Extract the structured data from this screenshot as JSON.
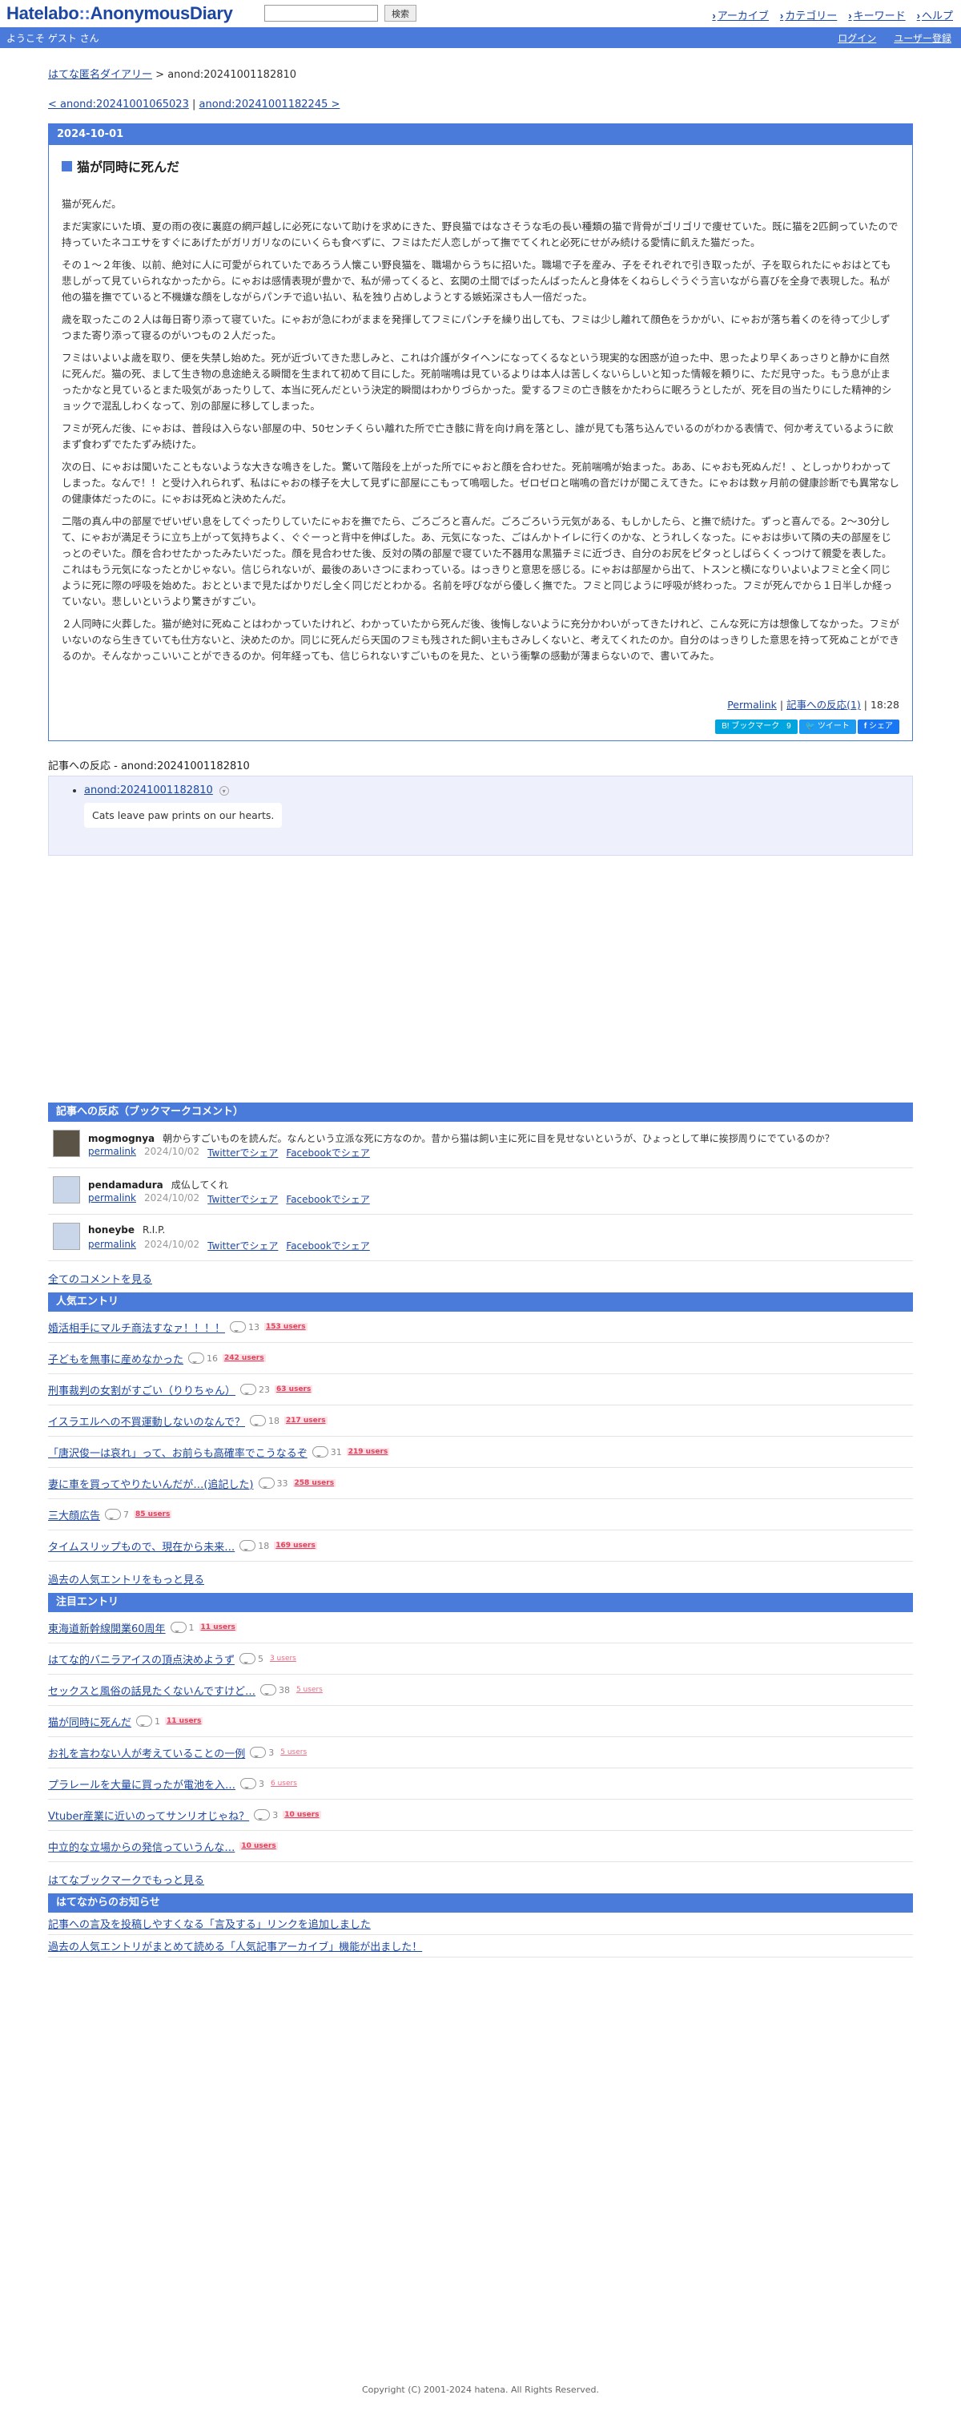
{
  "header": {
    "logo_part1": "Hatelabo",
    "logo_sep": "::",
    "logo_part2": "AnonymousDiary",
    "search_value": "",
    "search_button": "検索",
    "nav": [
      "アーカイブ",
      "カテゴリー",
      "キーワード",
      "ヘルプ"
    ]
  },
  "welcome": {
    "greeting": "ようこそ ゲスト さん",
    "login": "ログイン",
    "register": "ユーザー登録"
  },
  "breadcrumb": {
    "home": "はてな匿名ダイアリー",
    "sep": ">",
    "current": "anond:20241001182810"
  },
  "prevnext": {
    "prev": "< anond:20241001065023",
    "divider": "|",
    "next": "anond:20241001182245 >"
  },
  "entry": {
    "date": "2024-10-01",
    "title": "猫が同時に死んだ",
    "paragraphs": [
      "猫が死んだ。",
      "まだ実家にいた頃、夏の雨の夜に裏庭の網戸越しに必死にないて助けを求めにきた、野良猫ではなさそうな毛の長い種類の猫で背骨がゴリゴリで痩せていた。既に猫を2匹飼っていたので持っていたネコエサをすぐにあげたがガリガリなのにいくらも食べずに、フミはただ人恋しがって撫でてくれと必死にせがみ続ける愛情に飢えた猫だった。",
      "その１～２年後、以前、絶対に人に可愛がられていたであろう人懐こい野良猫を、職場からうちに招いた。職場で子を産み、子をそれぞれで引き取ったが、子を取られたにゃおはとても悲しがって見ていられなかったから。にゃおは感情表現が豊かで、私が帰ってくると、玄関の土間でばったんばったんと身体をくねらしぐうぐう言いながら喜びを全身で表現した。私が他の猫を撫でていると不機嫌な顔をしながらパンチで追い払い、私を独り占めしようとする嫉妬深さも人一倍だった。",
      "歳を取ったこの２人は毎日寄り添って寝ていた。にゃおが急にわがままを発揮してフミにパンチを繰り出しても、フミは少し離れて顔色をうかがい、にゃおが落ち着くのを待って少しずつまた寄り添って寝るのがいつもの２人だった。",
      "フミはいよいよ歳を取り、便を失禁し始めた。死が近づいてきた悲しみと、これは介護がタイヘンになってくるなという現実的な困惑が迫った中、思ったより早くあっさりと静かに自然に死んだ。猫の死、まして生き物の息途絶える瞬間を生まれて初めて目にした。死前喘鳴は見ているよりは本人は苦しくないらしいと知った情報を頼りに、ただ見守った。もう息が止まったかなと見ているとまた吸気があったりして、本当に死んだという決定的瞬間はわかりづらかった。愛するフミの亡き骸をかたわらに眠ろうとしたが、死を目の当たりにした精神的ショックで混乱しわくなって、別の部屋に移してしまった。",
      "フミが死んだ後、にゃおは、普段は入らない部屋の中、50センチくらい離れた所で亡き骸に背を向け肩を落とし、誰が見ても落ち込んでいるのがわかる表情で、何か考えているように飲まず食わずでたたずみ続けた。",
      "次の日、にゃおは聞いたこともないような大きな鳴きをした。驚いて階段を上がった所でにゃおと顔を合わせた。死前喘鳴が始まった。ああ、にゃおも死ぬんだ！、としっかりわかってしまった。なんで！！と受け入れられず、私はにゃおの様子を大して見ずに部屋にこもって鳴咽した。ゼロゼロと喘鳴の音だけが聞こえてきた。にゃおは数ヶ月前の健康診断でも異常なしの健康体だったのに。にゃおは死ぬと決めたんだ。",
      "二階の真ん中の部屋でぜいぜい息をしてぐったりしていたにゃおを撫でたら、ごろごろと喜んだ。ごろごろいう元気がある、もしかしたら、と撫で続けた。ずっと喜んでる。2〜30分して、にゃおが満足そうに立ち上がって気持ちよく、ぐぐーっと背中を伸ばした。あ、元気になった、ごはんかトイレに行くのかな、とうれしくなった。にゃおは歩いて隣の夫の部屋をじっとのぞいた。顔を合わせたかったみたいだった。顔を見合わせた後、反対の隣の部屋で寝ていた不器用な黒猫チミに近づき、自分のお尻をピタっとしばらくくっつけて親愛を表した。これはもう元気になったとかじゃない。信じられないが、最後のあいさつにまわっている。はっきりと意思を感じる。にゃおは部屋から出て、トスンと横になりいよいよフミと全く同じように死に際の呼吸を始めた。おとといまで見たばかりだし全く同じだとわかる。名前を呼びながら優しく撫でた。フミと同じように呼吸が終わった。フミが死んでから１日半しか経っていない。悲しいというより驚きがすごい。",
      "２人同時に火葬した。猫が絶対に死ぬことはわかっていたけれど、わかっていたから死んだ後、後悔しないように充分かわいがってきたけれど、こんな死に方は想像してなかった。フミがいないのなら生きていても仕方ないと、決めたのか。同じに死んだら天国のフミも残された飼い主もさみしくないと、考えてくれたのか。自分のはっきりした意思を持って死ぬことができるのか。そんなかっこいいことができるのか。何年経っても、信じられないすごいものを見た、という衝撃の感動が薄まらないので、書いてみた。"
    ],
    "permalink": "Permalink",
    "footer_sep": "|",
    "reactions_link": "記事への反応(1)",
    "time": "18:28",
    "hatebu_label": "B! ブックマーク",
    "hatebu_count": "9",
    "tweet_label": "ツイート",
    "share_label": "シェア"
  },
  "reactions": {
    "title": "記事への反応 - anond:20241001182810",
    "items": [
      {
        "link": "anond:20241001182810",
        "quote": "Cats leave paw prints on our hearts."
      }
    ]
  },
  "bookmarks": {
    "heading": "記事への反応（ブックマークコメント）",
    "permalink_label": "permalink",
    "twitter_label": "Twitterでシェア",
    "facebook_label": "Facebookでシェア",
    "items": [
      {
        "user": "mogmognya",
        "comment": "朝からすごいものを読んだ。なんという立派な死に方なのか。昔から猫は飼い主に死に目を見せないというが、ひょっとして単に挨拶周りにでているのか？",
        "date": "2024/10/02"
      },
      {
        "user": "pendamadura",
        "comment": "成仏してくれ",
        "date": "2024/10/02"
      },
      {
        "user": "honeybe",
        "comment": "R.I.P.",
        "date": "2024/10/02"
      }
    ],
    "all_comments": "全てのコメントを見る"
  },
  "popular": {
    "heading": "人気エントリ",
    "items": [
      {
        "title": "婚活相手にマルチ商法すなァ！！！！",
        "comments": "13",
        "users": "153 users"
      },
      {
        "title": "子どもを無事に産めなかった",
        "comments": "16",
        "users": "242 users"
      },
      {
        "title": "刑事裁判の女割がすごい（りりちゃん）",
        "comments": "23",
        "users": "63 users"
      },
      {
        "title": "イスラエルへの不買運動しないのなんで？",
        "comments": "18",
        "users": "217 users"
      },
      {
        "title": "「唐沢俊一は哀れ」って、お前らも高確率でこうなるぞ",
        "comments": "31",
        "users": "219 users"
      },
      {
        "title": "妻に車を買ってやりたいんだが…(追記した)",
        "comments": "33",
        "users": "258 users"
      },
      {
        "title": "三大顔広告",
        "comments": "7",
        "users": "85 users"
      },
      {
        "title": "タイムスリップもので、現在から未来…",
        "comments": "18",
        "users": "169 users"
      }
    ],
    "more": "過去の人気エントリをもっと見る"
  },
  "notable": {
    "heading": "注目エントリ",
    "items": [
      {
        "title": "東海道新幹線開業60周年",
        "comments": "1",
        "users": "11 users",
        "faint": false
      },
      {
        "title": "はてな的バニラアイスの頂点決めようず",
        "comments": "5",
        "users": "3 users",
        "faint": true
      },
      {
        "title": "セックスと風俗の話見たくないんですけど…",
        "comments": "38",
        "users": "5 users",
        "faint": true
      },
      {
        "title": "猫が同時に死んだ",
        "comments": "1",
        "users": "11 users",
        "faint": false
      },
      {
        "title": "お礼を言わない人が考えていることの一例",
        "comments": "3",
        "users": "5 users",
        "faint": true
      },
      {
        "title": "プラレールを大量に買ったが電池を入…",
        "comments": "3",
        "users": "6 users",
        "faint": true
      },
      {
        "title": "Vtuber産業に近いのってサンリオじゃね？",
        "comments": "3",
        "users": "10 users",
        "faint": false
      },
      {
        "title": "中立的な立場からの発信っていうんな…",
        "comments": "",
        "users": "10 users",
        "faint": false
      }
    ],
    "more": "はてなブックマークでもっと見る"
  },
  "news": {
    "heading": "はてなからのお知らせ",
    "items": [
      "記事への言及を投稿しやすくなる「言及する」リンクを追加しました",
      "過去の人気エントリがまとめて読める「人気記事アーカイブ」機能が出ました！"
    ]
  },
  "footer": {
    "copyright": "Copyright (C) 2001-2024 hatena. All Rights Reserved."
  },
  "colors": {
    "accent": "#4a7ada",
    "link": "#1d47a0",
    "users_badge": "#e0405a"
  }
}
